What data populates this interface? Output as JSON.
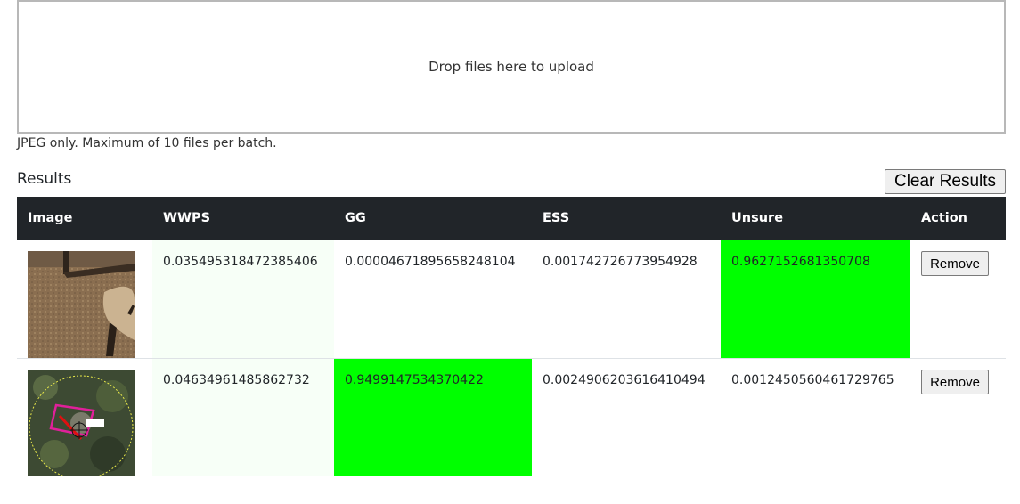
{
  "upload": {
    "dropzone_text": "Drop files here to upload",
    "note": "JPEG only. Maximum of 10 files per batch."
  },
  "results": {
    "title": "Results",
    "clear_label": "Clear Results",
    "columns": [
      "Image",
      "WWPS",
      "GG",
      "ESS",
      "Unsure",
      "Action"
    ],
    "rows": [
      {
        "image": "carpet-chair-photo",
        "wwps": "0.035495318472385406",
        "gg": "0.00004671895658248104",
        "ess": "0.001742726773954928",
        "unsure": "0.9627152681350708",
        "action_label": "Remove",
        "highlight": "unsure"
      },
      {
        "image": "aerial-map-photo",
        "wwps": "0.04634961485862732",
        "gg": "0.9499147534370422",
        "ess": "0.0024906203616410494",
        "unsure": "0.0012450560461729765",
        "action_label": "Remove",
        "highlight": "gg"
      }
    ]
  },
  "colors": {
    "header_bg": "#212529",
    "highlight": "#00ff00",
    "pale_green": "#f7fff7"
  }
}
